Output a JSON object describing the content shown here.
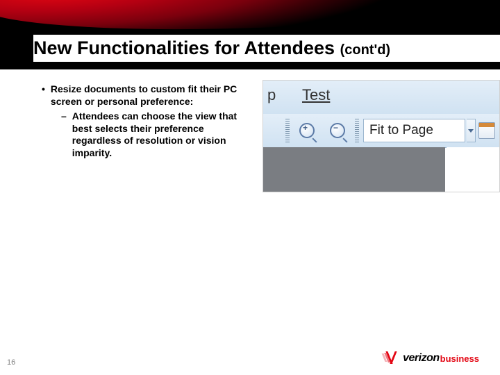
{
  "title": {
    "main": "New Functionalities for Attendees",
    "contd": "(cont'd)"
  },
  "bullets": {
    "main": "Resize documents to custom fit their PC screen or personal preference:",
    "sub": "Attendees can choose the view that best selects their preference regardless of resolution or vision imparity."
  },
  "toolbar": {
    "menu_p_fragment": "p",
    "menu_test": "Test",
    "zoom_in_sign": "+",
    "zoom_out_sign": "−",
    "fit_label": "Fit to Page"
  },
  "footer": {
    "page_number": "16",
    "logo_verizon": "verizon",
    "logo_business": "business"
  }
}
